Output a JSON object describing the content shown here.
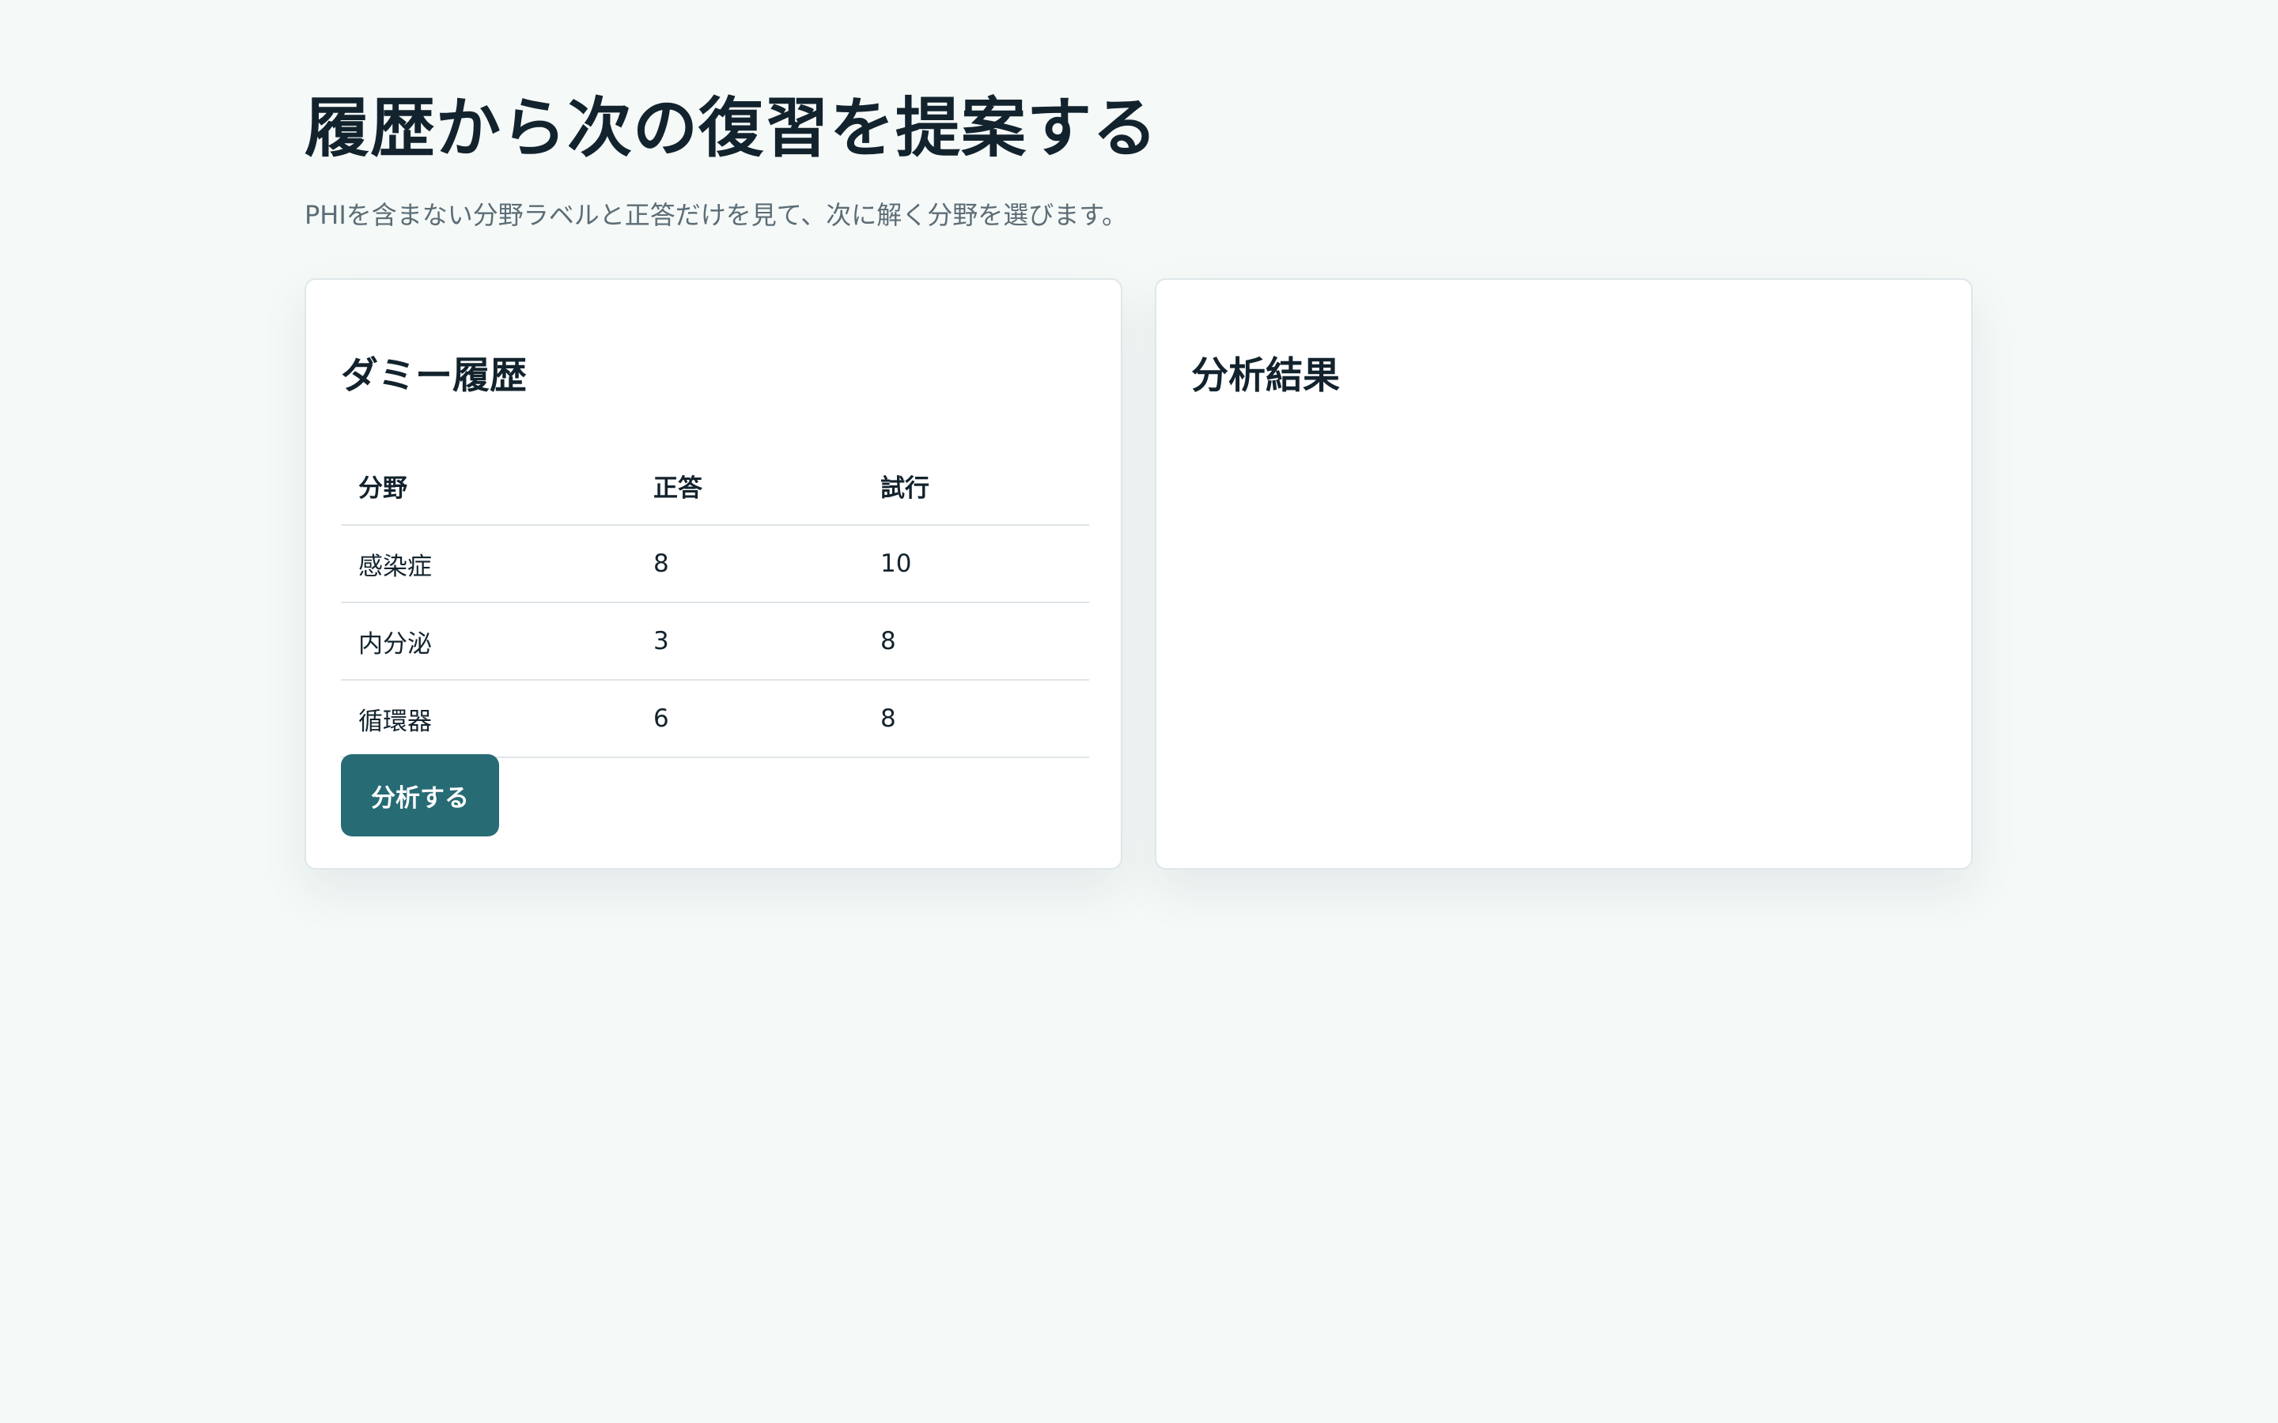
{
  "header": {
    "title": "履歴から次の復習を提案する",
    "subtitle": "PHIを含まない分野ラベルと正答だけを見て、次に解く分野を選びます。"
  },
  "history_card": {
    "title": "ダミー履歴",
    "columns": [
      "分野",
      "正答",
      "試行"
    ],
    "rows": [
      {
        "field": "感染症",
        "correct": "8",
        "attempts": "10"
      },
      {
        "field": "内分泌",
        "correct": "3",
        "attempts": "8"
      },
      {
        "field": "循環器",
        "correct": "6",
        "attempts": "8"
      }
    ],
    "analyze_label": "分析する"
  },
  "result_card": {
    "title": "分析結果"
  },
  "colors": {
    "background": "#f5f9f8",
    "accent": "#276b75",
    "text": "#13232d",
    "muted": "#5c6d76"
  }
}
